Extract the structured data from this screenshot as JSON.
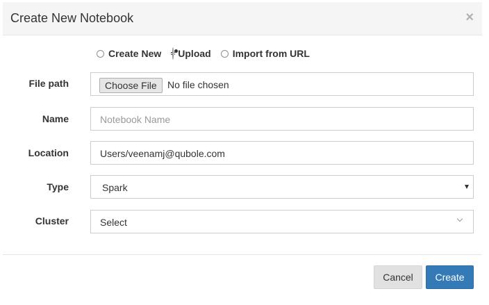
{
  "dialog": {
    "title": "Create New Notebook",
    "close_symbol": "×"
  },
  "mode": {
    "options": [
      "Create New",
      "Upload",
      "Import from URL"
    ],
    "selected": "Upload"
  },
  "form": {
    "file_path": {
      "label": "File path",
      "button_label": "Choose File",
      "status": "No file chosen"
    },
    "name": {
      "label": "Name",
      "value": "",
      "placeholder": "Notebook Name"
    },
    "location": {
      "label": "Location",
      "value": "Users/veenamj@qubole.com"
    },
    "type": {
      "label": "Type",
      "value": "Spark"
    },
    "cluster": {
      "label": "Cluster",
      "value": "Select"
    }
  },
  "footer": {
    "cancel_label": "Cancel",
    "create_label": "Create"
  },
  "colors": {
    "primary": "#337ab7",
    "header_bg": "#f5f5f5",
    "cancel_bg": "#e1e1e1"
  }
}
